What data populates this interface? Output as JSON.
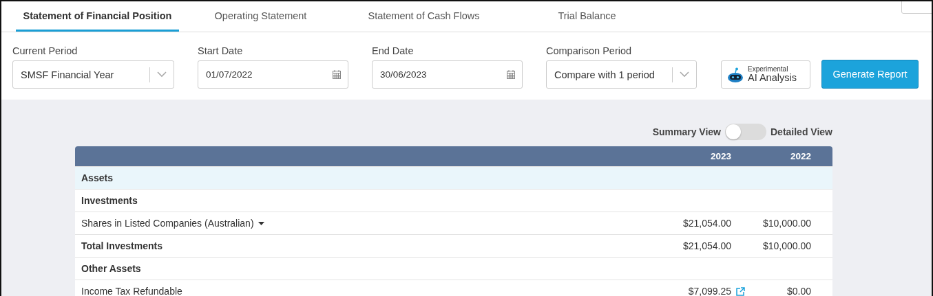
{
  "tabs": [
    {
      "label": "Statement of Financial Position",
      "selected": true
    },
    {
      "label": "Operating Statement",
      "selected": false
    },
    {
      "label": "Statement of Cash Flows",
      "selected": false
    },
    {
      "label": "Trial Balance",
      "selected": false
    }
  ],
  "filters": [
    {
      "kind": "select",
      "label": "Current Period",
      "value": "SMSF Financial Year"
    },
    {
      "kind": "date",
      "label": "Start Date",
      "value": "01/07/2022"
    },
    {
      "kind": "date",
      "label": "End Date",
      "value": "30/06/2023"
    },
    {
      "kind": "select",
      "label": "Comparison Period",
      "value": "Compare with 1 period"
    }
  ],
  "ai_button": {
    "badge": "Experimental",
    "label": "AI Analysis"
  },
  "generate_button": {
    "label": "Generate Report"
  },
  "view_toggle": {
    "left_label": "Summary View",
    "right_label": "Detailed View",
    "on": false
  },
  "table": {
    "columns": [
      "2023",
      "2022"
    ],
    "rows": [
      {
        "kind": "section",
        "label": "Assets",
        "dropdown": false,
        "link": false
      },
      {
        "kind": "group",
        "label": "Investments",
        "dropdown": false,
        "link": false
      },
      {
        "kind": "item",
        "label": "Shares in Listed Companies (Australian)",
        "values": [
          "$21,054.00",
          "$10,000.00"
        ],
        "dropdown": true,
        "link": false
      },
      {
        "kind": "total",
        "label": "Total Investments",
        "values": [
          "$21,054.00",
          "$10,000.00"
        ],
        "dropdown": false,
        "link": false
      },
      {
        "kind": "group",
        "label": "Other Assets",
        "dropdown": false,
        "link": false
      },
      {
        "kind": "item",
        "label": "Income Tax Refundable",
        "values": [
          "$7,099.25",
          "$0.00"
        ],
        "dropdown": false,
        "link": true
      }
    ]
  }
}
